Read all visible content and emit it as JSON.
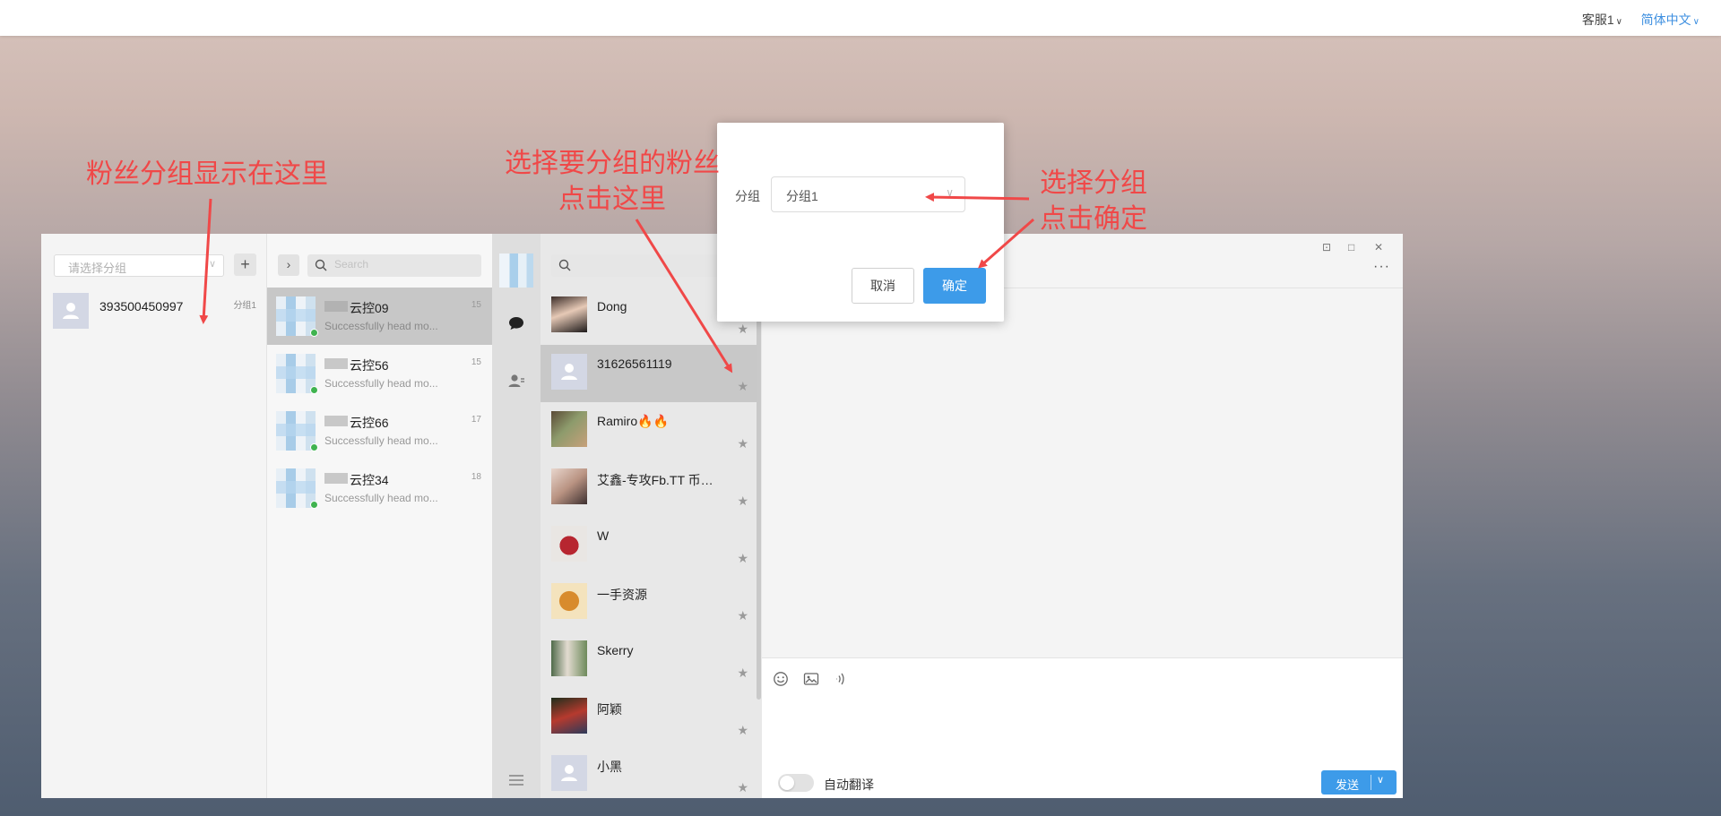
{
  "topbar": {
    "account": "客服1",
    "language": "简体中文"
  },
  "groups_panel": {
    "select_placeholder": "请选择分组",
    "add_label": "+",
    "fans": [
      {
        "name": "393500450997",
        "group": "分组1"
      }
    ]
  },
  "accounts_panel": {
    "expand_label": "›",
    "search_placeholder": "Search",
    "accounts": [
      {
        "name": "云控09",
        "preview": "Successfully head mo...",
        "count": "15",
        "active": true
      },
      {
        "name": "云控56",
        "preview": "Successfully head mo...",
        "count": "15",
        "active": false
      },
      {
        "name": "云控66",
        "preview": "Successfully head mo...",
        "count": "17",
        "active": false
      },
      {
        "name": "云控34",
        "preview": "Successfully head mo...",
        "count": "18",
        "active": false
      }
    ]
  },
  "contacts_panel": {
    "search_placeholder": "",
    "contacts": [
      {
        "name": "Dong",
        "avatar": "photo"
      },
      {
        "name": "31626561119",
        "avatar": "default",
        "active": true
      },
      {
        "name": "Ramiro🔥🔥",
        "avatar": "photo"
      },
      {
        "name": "艾鑫-专攻Fb.TT 币…",
        "avatar": "photo"
      },
      {
        "name": "W",
        "avatar": "photo"
      },
      {
        "name": "一手资源",
        "avatar": "photo"
      },
      {
        "name": "Skerry",
        "avatar": "photo"
      },
      {
        "name": "阿颖",
        "avatar": "photo"
      },
      {
        "name": "小黑",
        "avatar": "default"
      }
    ]
  },
  "chat": {
    "more_label": "···",
    "auto_translate_label": "自动翻译",
    "send_label": "发送"
  },
  "dialog": {
    "field_label": "分组",
    "selected_group": "分组1",
    "cancel_label": "取消",
    "confirm_label": "确定"
  },
  "annotations": {
    "fan_groups": "粉丝分组显示在这里",
    "select_fans_line1": "选择要分组的粉丝",
    "select_fans_line2": "点击这里",
    "select_group_line1": "选择分组",
    "select_group_line2": "点击确定"
  },
  "colors": {
    "accent": "#3d9be9",
    "annotation": "#f04848",
    "online": "#3fb34f"
  }
}
